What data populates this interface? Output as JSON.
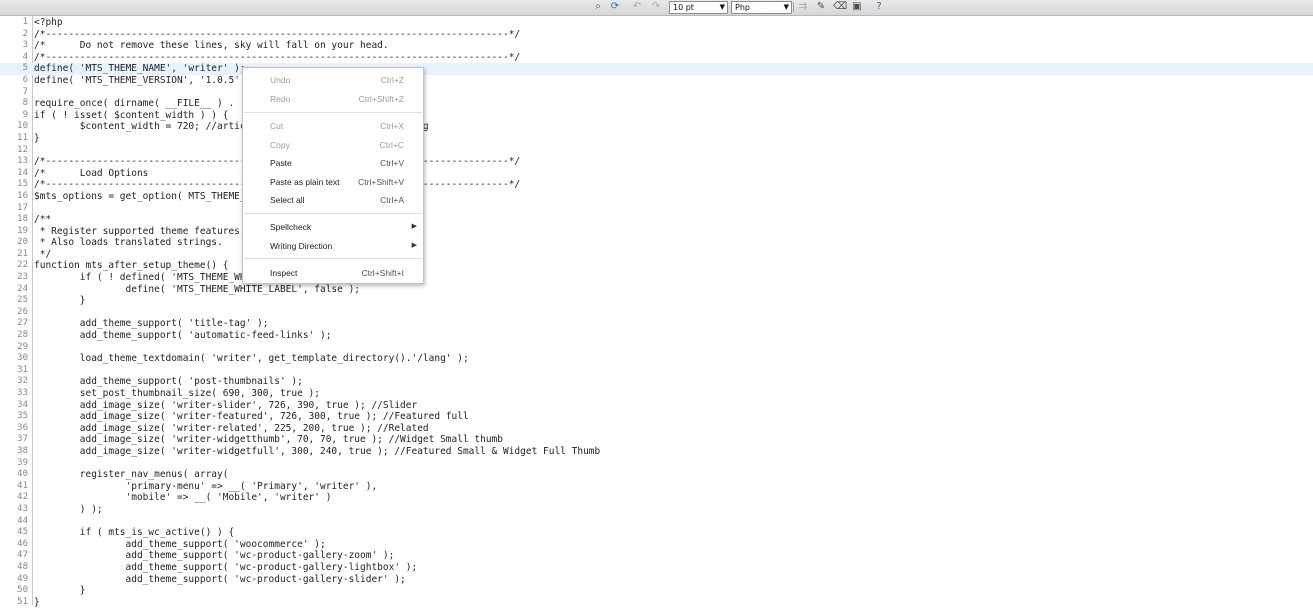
{
  "toolbar": {
    "font_size": "10 pt",
    "language": "Php",
    "icons": [
      "binoculars-icon",
      "replace-icon",
      "undo-icon",
      "redo-icon",
      "wrap-icon",
      "eraser-icon",
      "clean-icon",
      "fullscreen-icon",
      "help-icon"
    ]
  },
  "editor": {
    "lines": [
      {
        "n": "1",
        "t": "<?php"
      },
      {
        "n": "2",
        "t": "/*---------------------------------------------------------------------------------*/"
      },
      {
        "n": "3",
        "t": "/*      Do not remove these lines, sky will fall on your head."
      },
      {
        "n": "4",
        "t": "/*---------------------------------------------------------------------------------*/"
      },
      {
        "n": "5",
        "t": "define( 'MTS_THEME_NAME', 'writer' );"
      },
      {
        "n": "6",
        "t": "define( 'MTS_THEME_VERSION', '1.0.5' );"
      },
      {
        "n": "7",
        "t": ""
      },
      {
        "n": "8",
        "t": "require_once( dirname( __FILE__ ) . '/theme-options.php' );"
      },
      {
        "n": "9",
        "t": "if ( ! isset( $content_width ) ) {"
      },
      {
        "n": "10",
        "t": "        $content_width = 720; //article content width without padding"
      },
      {
        "n": "11",
        "t": "}"
      },
      {
        "n": "12",
        "t": ""
      },
      {
        "n": "13",
        "t": "/*---------------------------------------------------------------------------------*/"
      },
      {
        "n": "14",
        "t": "/*      Load Options"
      },
      {
        "n": "15",
        "t": "/*---------------------------------------------------------------------------------*/"
      },
      {
        "n": "16",
        "t": "$mts_options = get_option( MTS_THEME_NAME );"
      },
      {
        "n": "17",
        "t": ""
      },
      {
        "n": "18",
        "t": "/**"
      },
      {
        "n": "19",
        "t": " * Register supported theme features, image sizes and nav menus."
      },
      {
        "n": "20",
        "t": " * Also loads translated strings."
      },
      {
        "n": "21",
        "t": " */"
      },
      {
        "n": "22",
        "t": "function mts_after_setup_theme() {"
      },
      {
        "n": "23",
        "t": "        if ( ! defined( 'MTS_THEME_WHITE_LABEL' ) ) {"
      },
      {
        "n": "24",
        "t": "                define( 'MTS_THEME_WHITE_LABEL', false );"
      },
      {
        "n": "25",
        "t": "        }"
      },
      {
        "n": "26",
        "t": ""
      },
      {
        "n": "27",
        "t": "        add_theme_support( 'title-tag' );"
      },
      {
        "n": "28",
        "t": "        add_theme_support( 'automatic-feed-links' );"
      },
      {
        "n": "29",
        "t": ""
      },
      {
        "n": "30",
        "t": "        load_theme_textdomain( 'writer', get_template_directory().'/lang' );"
      },
      {
        "n": "31",
        "t": ""
      },
      {
        "n": "32",
        "t": "        add_theme_support( 'post-thumbnails' );"
      },
      {
        "n": "33",
        "t": "        set_post_thumbnail_size( 690, 300, true );"
      },
      {
        "n": "34",
        "t": "        add_image_size( 'writer-slider', 726, 390, true ); //Slider"
      },
      {
        "n": "35",
        "t": "        add_image_size( 'writer-featured', 726, 300, true ); //Featured full"
      },
      {
        "n": "36",
        "t": "        add_image_size( 'writer-related', 225, 200, true ); //Related"
      },
      {
        "n": "37",
        "t": "        add_image_size( 'writer-widgetthumb', 70, 70, true ); //Widget Small thumb"
      },
      {
        "n": "38",
        "t": "        add_image_size( 'writer-widgetfull', 300, 240, true ); //Featured Small & Widget Full Thumb"
      },
      {
        "n": "39",
        "t": ""
      },
      {
        "n": "40",
        "t": "        register_nav_menus( array("
      },
      {
        "n": "41",
        "t": "                'primary-menu' => __( 'Primary', 'writer' ),"
      },
      {
        "n": "42",
        "t": "                'mobile' => __( 'Mobile', 'writer' )"
      },
      {
        "n": "43",
        "t": "        ) );"
      },
      {
        "n": "44",
        "t": ""
      },
      {
        "n": "45",
        "t": "        if ( mts_is_wc_active() ) {"
      },
      {
        "n": "46",
        "t": "                add_theme_support( 'woocommerce' );"
      },
      {
        "n": "47",
        "t": "                add_theme_support( 'wc-product-gallery-zoom' );"
      },
      {
        "n": "48",
        "t": "                add_theme_support( 'wc-product-gallery-lightbox' );"
      },
      {
        "n": "49",
        "t": "                add_theme_support( 'wc-product-gallery-slider' );"
      },
      {
        "n": "50",
        "t": "        }"
      },
      {
        "n": "51",
        "t": "}"
      }
    ]
  },
  "context_menu": {
    "undo": {
      "label": "Undo",
      "shortcut": "Ctrl+Z"
    },
    "redo": {
      "label": "Redo",
      "shortcut": "Ctrl+Shift+Z"
    },
    "cut": {
      "label": "Cut",
      "shortcut": "Ctrl+X"
    },
    "copy": {
      "label": "Copy",
      "shortcut": "Ctrl+C"
    },
    "paste": {
      "label": "Paste",
      "shortcut": "Ctrl+V"
    },
    "paste_plain": {
      "label": "Paste as plain text",
      "shortcut": "Ctrl+Shift+V"
    },
    "select_all": {
      "label": "Select all",
      "shortcut": "Ctrl+A"
    },
    "spellcheck": {
      "label": "Spellcheck"
    },
    "writing_direction": {
      "label": "Writing Direction"
    },
    "inspect": {
      "label": "Inspect",
      "shortcut": "Ctrl+Shift+I"
    }
  }
}
